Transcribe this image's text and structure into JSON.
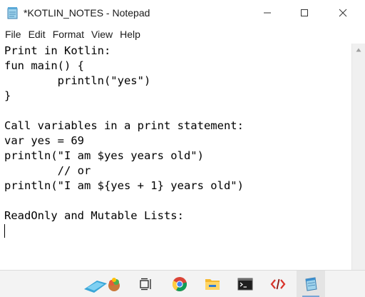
{
  "window": {
    "title": "*KOTLIN_NOTES - Notepad"
  },
  "menu": {
    "items": [
      "File",
      "Edit",
      "Format",
      "View",
      "Help"
    ]
  },
  "editor": {
    "lines": [
      "Print in Kotlin:",
      "fun main() {",
      "        println(\"yes\")",
      "}",
      "",
      "Call variables in a print statement:",
      "var yes = 69",
      "println(\"I am $yes years old\")",
      "        // or",
      "println(\"I am ${yes + 1} years old\")",
      "",
      "ReadOnly and Mutable Lists:"
    ]
  },
  "taskbar": {
    "items": [
      "widgets-icon",
      "task-view-icon",
      "chrome-icon",
      "file-explorer-icon",
      "terminal-icon",
      "code-editor-icon",
      "notepad-icon"
    ]
  },
  "colors": {
    "text": "#000000",
    "taskbar": "#f3f3f3",
    "scrollbar": "#f0f0f0"
  }
}
